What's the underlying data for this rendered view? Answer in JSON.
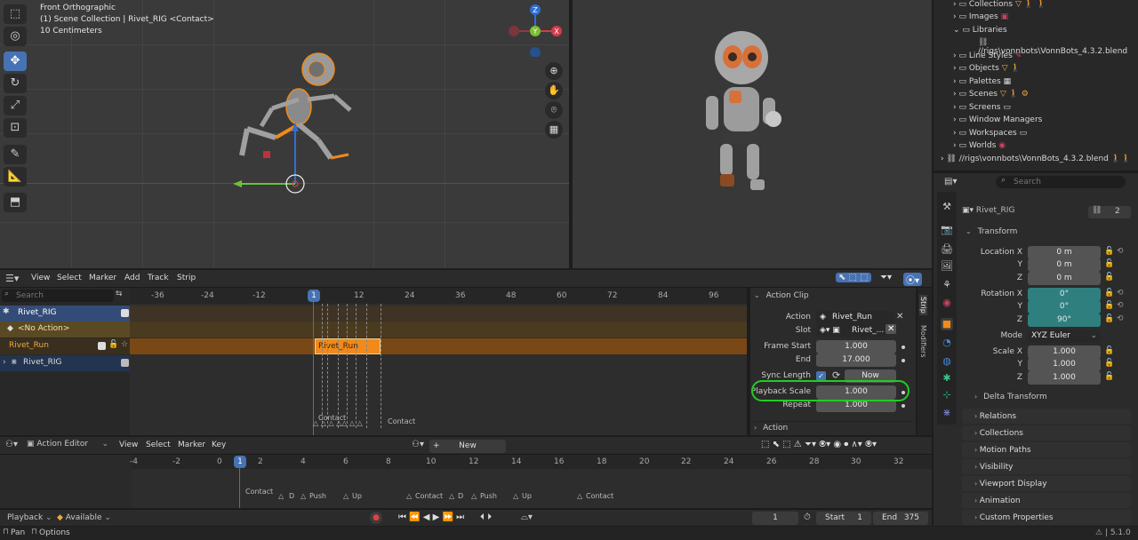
{
  "viewport_left": {
    "title": "Front Orthographic",
    "collection": "(1) Scene Collection | Rivet_RIG <Contact>",
    "scale": "10 Centimeters",
    "gizmo": {
      "z": "Z",
      "y": "Y",
      "x": "X"
    }
  },
  "nla": {
    "menus": [
      "View",
      "Select",
      "Marker",
      "Add",
      "Track",
      "Strip"
    ],
    "search_placeholder": "Search",
    "ticks": [
      "-36",
      "-24",
      "-12",
      "1",
      "12",
      "24",
      "36",
      "48",
      "60",
      "72",
      "84",
      "96"
    ],
    "tracks": {
      "rig": "Rivet_RIG",
      "no_action": "<No Action>",
      "run": "Rivet_Run",
      "rig2": "Rivet_RIG"
    },
    "strip_label": "Rivet_Run",
    "markers": [
      "Contact",
      "Contact"
    ],
    "side_tabs": [
      "Strip",
      "Modifiers"
    ],
    "panel": {
      "section": "Action Clip",
      "action_label": "Action",
      "action_value": "Rivet_Run",
      "slot_label": "Slot",
      "slot_value": "Rivet_...",
      "frame_start_label": "Frame Start",
      "frame_start_value": "1.000",
      "end_label": "End",
      "end_value": "17.000",
      "sync_label": "Sync Length",
      "now_label": "Now",
      "playback_label": "Playback Scale",
      "playback_value": "1.000",
      "repeat_label": "Repeat",
      "repeat_value": "1.000",
      "action_section": "Action"
    }
  },
  "action_editor": {
    "mode": "Action Editor",
    "menus": [
      "View",
      "Select",
      "Marker",
      "Key"
    ],
    "new_label": "New",
    "ticks": [
      "-4",
      "-2",
      "0",
      "1",
      "2",
      "4",
      "6",
      "8",
      "10",
      "12",
      "14",
      "16",
      "18",
      "20",
      "22",
      "24",
      "26",
      "28",
      "30",
      "32"
    ],
    "markers": [
      "Contact",
      "D",
      "Push",
      "Up",
      "Contact",
      "D",
      "Push",
      "Up",
      "Contact"
    ]
  },
  "playback_bar": {
    "playback_label": "Playback",
    "keying_label": "Available",
    "current_frame": "1",
    "start_label": "Start",
    "start_value": "1",
    "end_label": "End",
    "end_value": "375"
  },
  "status_bar": {
    "pan": "Pan",
    "options": "Options",
    "version": "5.1.0"
  },
  "outliner": {
    "items": [
      "Collections",
      "Images",
      "Libraries",
      "//rigs\\vonnbots\\VonnBots_4.3.2.blend",
      "Line Styles",
      "Objects",
      "Palettes",
      "Scenes",
      "Screens",
      "Window Managers",
      "Workspaces",
      "Worlds",
      "//rigs\\vonnbots\\VonnBots_4.3.2.blend"
    ]
  },
  "properties": {
    "search_placeholder": "Search",
    "object_name": "Rivet_RIG",
    "users": "2",
    "transform_label": "Transform",
    "location_x_label": "Location X",
    "location_x": "0 m",
    "location_y": "0 m",
    "location_z": "0 m",
    "rotation_x_label": "Rotation X",
    "rotation_x": "0°",
    "rotation_y": "0°",
    "rotation_z": "90°",
    "mode_label": "Mode",
    "mode_value": "XYZ Euler",
    "scale_x_label": "Scale X",
    "scale_x": "1.000",
    "scale_y": "1.000",
    "scale_z": "1.000",
    "y_label": "Y",
    "z_label": "Z",
    "delta_transform": "Delta Transform",
    "sections": [
      "Relations",
      "Collections",
      "Motion Paths",
      "Visibility",
      "Viewport Display",
      "Animation",
      "Custom Properties"
    ]
  },
  "colors": {
    "accent": "#4772b3",
    "strip_orange": "#f08a1c",
    "highlight_green": "#22cc22",
    "teal_field": "#2f7f7f"
  }
}
